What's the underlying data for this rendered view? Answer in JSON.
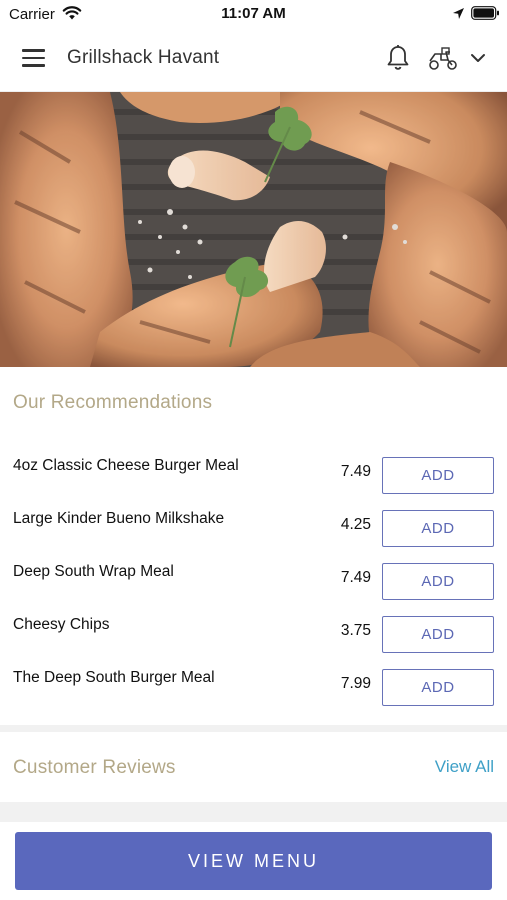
{
  "status_bar": {
    "carrier": "Carrier",
    "time": "11:07 AM",
    "icons": [
      "wifi-icon",
      "location-icon",
      "battery-icon"
    ]
  },
  "header": {
    "title": "Grillshack Havant",
    "icons": [
      "menu-icon",
      "bell-icon",
      "delivery-icon",
      "chevron-down-icon"
    ]
  },
  "hero": {
    "image": "grilled-chicken-photo"
  },
  "recommendations": {
    "title": "Our Recommendations",
    "add_label": "ADD",
    "items": [
      {
        "name": "4oz Classic Cheese Burger Meal",
        "price": "7.49"
      },
      {
        "name": "Large Kinder Bueno Milkshake",
        "price": "4.25"
      },
      {
        "name": "Deep South Wrap Meal",
        "price": "7.49"
      },
      {
        "name": "Cheesy Chips",
        "price": "3.75"
      },
      {
        "name": "The Deep South Burger Meal",
        "price": "7.99"
      }
    ]
  },
  "reviews": {
    "title": "Customer Reviews",
    "view_all": "View All"
  },
  "footer": {
    "view_menu_label": "VIEW MENU"
  },
  "colors": {
    "accent": "#5a68bd",
    "section_title": "#b3a888",
    "link": "#3fa0c7"
  }
}
